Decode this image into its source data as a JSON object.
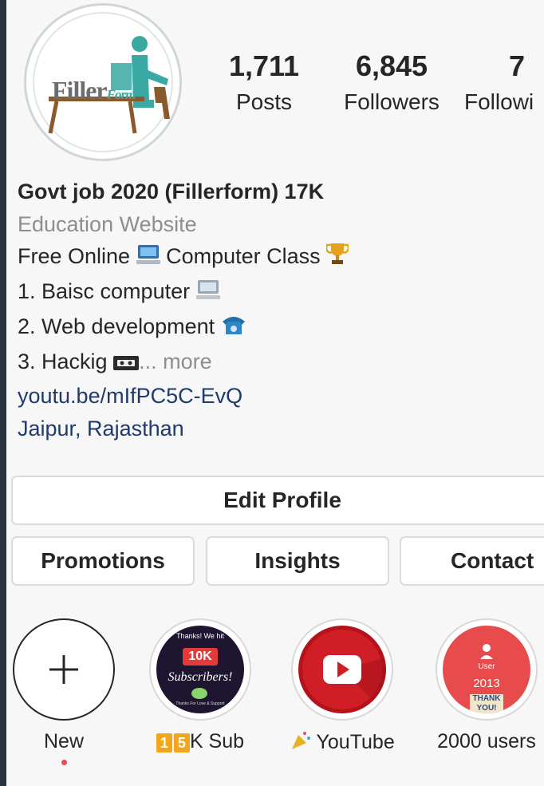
{
  "profile": {
    "avatar_logo_main": "Filler",
    "avatar_logo_small": "Form",
    "stats": [
      {
        "value": "1,711",
        "label": "Posts"
      },
      {
        "value": "6,845",
        "label": "Followers"
      },
      {
        "value": "7",
        "label": "Followi"
      }
    ],
    "name": "Govt job 2020 (Fillerform) 17K",
    "category": "Education Website",
    "bio_lines": [
      "Free Online",
      "Computer Class",
      "1. Baisc computer",
      "2. Web development",
      "3. Hackig"
    ],
    "more_label": "... more",
    "link": "youtu.be/mIfPC5C-EvQ",
    "location": "Jaipur, Rajasthan"
  },
  "buttons": {
    "edit_profile": "Edit Profile",
    "promotions": "Promotions",
    "insights": "Insights",
    "contact": "Contact"
  },
  "highlights": [
    {
      "caption": "New",
      "icon": "plus-icon"
    },
    {
      "caption_digit1": "1",
      "caption_digit2": "5",
      "caption_rest": "K Sub",
      "top_text": "Thanks! We hit",
      "badge": "10K",
      "script_text": "Subscribers!",
      "small_text": "Thanks For Love & Support"
    },
    {
      "caption": "YouTube",
      "icon": "youtube-play-icon"
    },
    {
      "caption": "2000 users",
      "line1": "User",
      "year": "2013",
      "thank": "THANK",
      "you": "YOU!"
    }
  ],
  "colors": {
    "text": "#262626",
    "muted": "#8e8e8e",
    "link": "#1f3a6b",
    "border": "#dbdbdb",
    "notify_dot": "#ed4956",
    "youtube_red": "#e02626"
  }
}
